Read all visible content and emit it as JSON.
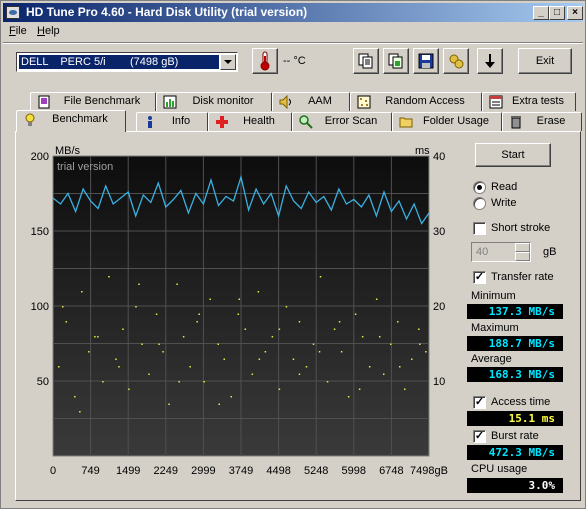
{
  "window": {
    "title": "HD Tune Pro 4.60 - Hard Disk Utility (trial version)",
    "controls": [
      "_",
      "□",
      "×"
    ]
  },
  "menu": [
    "File",
    "Help"
  ],
  "toolbar": {
    "drive": "DELL    PERC 5/i        (7498 gB)",
    "temperature": "-- °C",
    "exit_label": "Exit",
    "icons": [
      "thermometer-icon",
      "copy-text-icon",
      "copy-screenshot-icon",
      "save-icon",
      "options-icon",
      "download-icon"
    ]
  },
  "tabs_top": [
    {
      "label": "File Benchmark",
      "icon": "file-benchmark-icon"
    },
    {
      "label": "Disk monitor",
      "icon": "disk-monitor-icon"
    },
    {
      "label": "AAM",
      "icon": "speaker-icon"
    },
    {
      "label": "Random Access",
      "icon": "random-access-icon"
    },
    {
      "label": "Extra tests",
      "icon": "extra-tests-icon"
    }
  ],
  "tabs_bottom": [
    {
      "label": "Benchmark",
      "icon": "lightbulb-icon",
      "active": true
    },
    {
      "label": "Info",
      "icon": "info-icon"
    },
    {
      "label": "Health",
      "icon": "health-cross-icon"
    },
    {
      "label": "Error Scan",
      "icon": "magnifier-icon"
    },
    {
      "label": "Folder Usage",
      "icon": "folder-icon"
    },
    {
      "label": "Erase",
      "icon": "trash-icon"
    }
  ],
  "controls": {
    "start_label": "Start",
    "read_label": "Read",
    "write_label": "Write",
    "mode": "Read",
    "short_stroke_label": "Short stroke",
    "short_stroke_checked": false,
    "short_stroke_value": "40",
    "short_stroke_unit": "gB",
    "transfer_rate_label": "Transfer rate",
    "transfer_rate_checked": true,
    "access_time_label": "Access time",
    "access_time_checked": true,
    "burst_rate_label": "Burst rate",
    "burst_rate_checked": true
  },
  "results": {
    "minimum_label": "Minimum",
    "minimum": "137.3 MB/s",
    "maximum_label": "Maximum",
    "maximum": "188.7 MB/s",
    "average_label": "Average",
    "average": "168.3 MB/s",
    "access_time": "15.1 ms",
    "burst_rate": "472.3 MB/s",
    "cpu_label": "CPU usage",
    "cpu_usage": "3.0%"
  },
  "colors": {
    "transfer_line": "#3ab0e0",
    "access_dots": "#e8e840",
    "plot_bg": "#1a1a1a",
    "value_cyan": "#00e5ff",
    "value_yellow": "#ffff40"
  },
  "chart_data": {
    "type": "line",
    "watermark": "trial version",
    "y_left_label": "MB/s",
    "y_right_label": "ms",
    "ylim": [
      0,
      200
    ],
    "y2lim": [
      0,
      40
    ],
    "y_ticks": [
      "200",
      "150",
      "100",
      "50"
    ],
    "y2_ticks": [
      "40",
      "30",
      "20",
      "10"
    ],
    "x_ticks": [
      "0",
      "749",
      "1499",
      "2249",
      "2999",
      "3749",
      "4498",
      "5248",
      "5998",
      "6748",
      "7498gB"
    ],
    "xlim": [
      0,
      7498
    ],
    "grid": true,
    "series": [
      {
        "name": "Transfer rate",
        "axis": "left",
        "x": [
          0,
          150,
          300,
          450,
          600,
          749,
          900,
          1050,
          1200,
          1350,
          1499,
          1650,
          1800,
          1950,
          2100,
          2249,
          2400,
          2550,
          2700,
          2850,
          2999,
          3150,
          3300,
          3450,
          3600,
          3749,
          3900,
          4050,
          4200,
          4350,
          4498,
          4650,
          4800,
          4950,
          5100,
          5248,
          5400,
          5550,
          5700,
          5850,
          5998,
          6150,
          6300,
          6450,
          6600,
          6748,
          6900,
          7050,
          7200,
          7350,
          7498
        ],
        "values": [
          172,
          168,
          175,
          163,
          178,
          170,
          165,
          180,
          168,
          172,
          176,
          160,
          174,
          169,
          182,
          166,
          171,
          177,
          162,
          175,
          168,
          184,
          167,
          173,
          170,
          186,
          164,
          178,
          168,
          175,
          160,
          180,
          170,
          165,
          176,
          169,
          173,
          164,
          178,
          168,
          171,
          166,
          174,
          160,
          176,
          163,
          170,
          158,
          168,
          155,
          162
        ]
      },
      {
        "name": "Access time",
        "axis": "right",
        "style": "scatter",
        "x": [
          100,
          250,
          420,
          560,
          700,
          820,
          980,
          1100,
          1240,
          1380,
          1500,
          1640,
          1760,
          1900,
          2050,
          2180,
          2300,
          2460,
          2590,
          2720,
          2860,
          3000,
          3120,
          3280,
          3400,
          3540,
          3680,
          3820,
          3960,
          4080,
          4220,
          4360,
          4500,
          4640,
          4780,
          4900,
          5040,
          5180,
          5320,
          5460,
          5600,
          5740,
          5880,
          6020,
          6160,
          6300,
          6440,
          6580,
          6720,
          6860,
          7000,
          7140,
          7280,
          7420,
          180,
          520,
          880,
          1300,
          1700,
          2100,
          2500,
          2900,
          3300,
          3700,
          4100,
          4500,
          4900,
          5300,
          5700,
          6100,
          6500,
          6900,
          7300
        ],
        "values": [
          12,
          18,
          8,
          22,
          14,
          16,
          10,
          24,
          13,
          17,
          9,
          20,
          15,
          11,
          19,
          14,
          7,
          23,
          16,
          12,
          18,
          10,
          21,
          15,
          13,
          8,
          19,
          17,
          11,
          22,
          14,
          16,
          9,
          20,
          13,
          18,
          12,
          15,
          24,
          10,
          17,
          14,
          8,
          19,
          16,
          12,
          21,
          11,
          15,
          18,
          9,
          13,
          17,
          14,
          20,
          6,
          16,
          12,
          23,
          15,
          10,
          19,
          7,
          21,
          13,
          17,
          11,
          14,
          18,
          9,
          16,
          12,
          15
        ]
      }
    ]
  }
}
